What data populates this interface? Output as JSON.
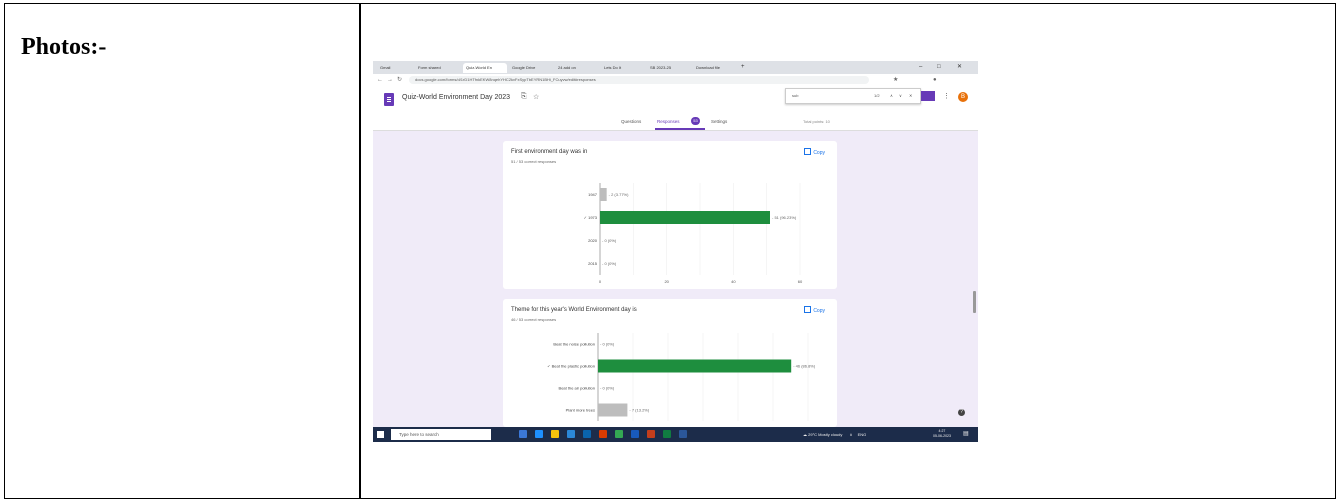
{
  "document": {
    "photos_label": "Photos:-"
  },
  "screenshot": {
    "browser_tabs": [
      {
        "label": "Gmail",
        "active": false
      },
      {
        "label": "Form shared",
        "active": false
      },
      {
        "label": "Quiz-World En",
        "active": true
      },
      {
        "label": "Google Drive",
        "active": false
      },
      {
        "label": "24 add on",
        "active": false
      },
      {
        "label": "Lets Do It",
        "active": false
      },
      {
        "label": "SB 2023-25",
        "active": false
      },
      {
        "label": "Download file",
        "active": false
      }
    ],
    "url": "docs.google.com/forms/d/1rD1HTfnkEKW8nqehYHC2kvFxSypTbEYRN1BHi_FCuyvw/edit#responses",
    "find_text": "sub",
    "find_count": "1/2",
    "form": {
      "title": "Quiz-World Environment Day 2023",
      "avatar_letter": "B",
      "tabs": [
        {
          "label": "Questions"
        },
        {
          "label": "Responses"
        },
        {
          "label": "Settings"
        }
      ],
      "response_count": "53",
      "total_points": "Total points: 10"
    },
    "colors": {
      "accent": "#673ab7",
      "bar_correct": "#1e8e3e",
      "bar_other": "#bdbdbd",
      "link": "#1a73e8"
    },
    "questions": [
      {
        "title": "First environment day was in",
        "subtitle": "51 / 53 correct responses",
        "copy_label": "Copy",
        "chart_data": {
          "type": "bar",
          "orientation": "horizontal",
          "categories": [
            "1947",
            "✓ 1973",
            "2020",
            "2015"
          ],
          "values": [
            2,
            51,
            0,
            0
          ],
          "labels": [
            "2 (3.77%)",
            "51 (96.23%)",
            "0 (0%)",
            "0 (0%)"
          ],
          "correct_index": 1,
          "xlim": [
            0,
            60
          ],
          "ticks": [
            "0",
            "20",
            "40",
            "60"
          ]
        }
      },
      {
        "title": "Theme for this year's World Environment day is",
        "subtitle": "46 / 53 correct responses",
        "copy_label": "Copy",
        "chart_data": {
          "type": "bar",
          "orientation": "horizontal",
          "categories": [
            "Beat the noise pollution",
            "✓ Beat the plastic pollution",
            "Beat the air pollution",
            "Plant more trees"
          ],
          "values": [
            0,
            46,
            0,
            7
          ],
          "labels": [
            "0 (0%)",
            "46 (86.8%)",
            "0 (0%)",
            "7 (13.2%)"
          ],
          "correct_index": 1,
          "xlim": [
            0,
            50
          ]
        }
      }
    ],
    "taskbar": {
      "search_placeholder": "Type here to search",
      "weather": "29°C Mostly cloudy",
      "language": "ENG",
      "time": "4:27",
      "date": "05-06-2023"
    }
  }
}
